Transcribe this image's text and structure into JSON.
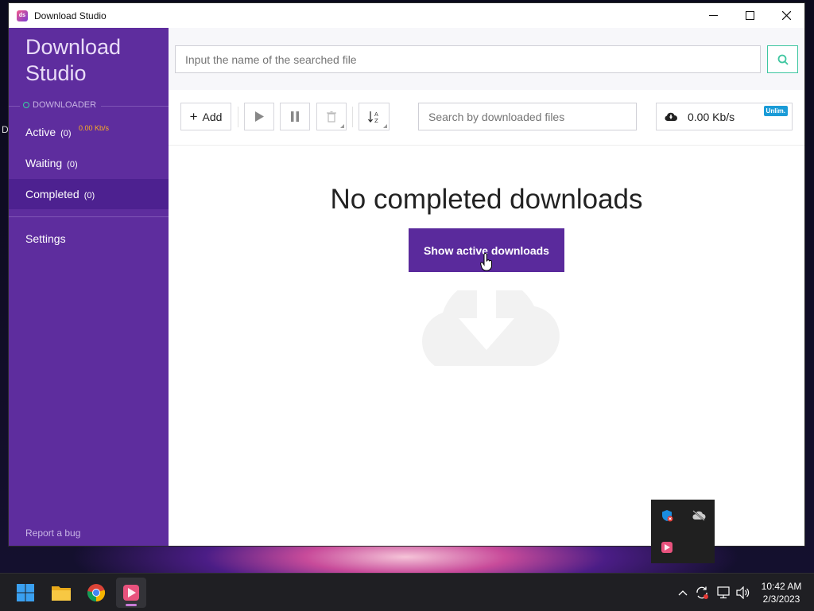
{
  "window": {
    "title": "Download Studio",
    "minimize": "—",
    "maximize": "☐",
    "close": "✕"
  },
  "sidebar": {
    "brand_line1": "Download",
    "brand_line2": "Studio",
    "section": "DOWNLOADER",
    "items": [
      {
        "label": "Active",
        "count": "(0)"
      },
      {
        "label": "Waiting",
        "count": "(0)"
      },
      {
        "label": "Completed",
        "count": "(0)"
      }
    ],
    "active_speed": "0.00 Kb/s",
    "settings": "Settings",
    "report": "Report a bug"
  },
  "search": {
    "placeholder": "Input the name of the searched file"
  },
  "toolbar": {
    "add_label": "Add",
    "download_search_placeholder": "Search by downloaded files",
    "speed": "0.00 Kb/s",
    "speed_badge": "Unlim."
  },
  "main": {
    "empty_title": "No completed downloads",
    "show_button": "Show active downloads"
  },
  "taskbar": {
    "time": "10:42 AM",
    "date": "2/3/2023"
  },
  "desktop": {
    "stray_char": "D"
  },
  "colors": {
    "sidebar": "#5e2d9e",
    "sidebar_active": "#4d2190",
    "accent_green": "#3ec6a0",
    "button_primary": "#5a2a9c",
    "speed_orange": "#ffb020",
    "badge_blue": "#1a9bd7"
  },
  "icons": [
    "app-logo-icon",
    "search-icon",
    "play-icon",
    "pause-icon",
    "trash-icon",
    "sort-icon",
    "cloud-download-icon",
    "windows-start-icon",
    "file-explorer-icon",
    "chrome-icon",
    "download-studio-icon",
    "chevron-up-icon",
    "sync-icon",
    "network-icon",
    "volume-icon",
    "security-icon",
    "cloud-offline-icon"
  ]
}
